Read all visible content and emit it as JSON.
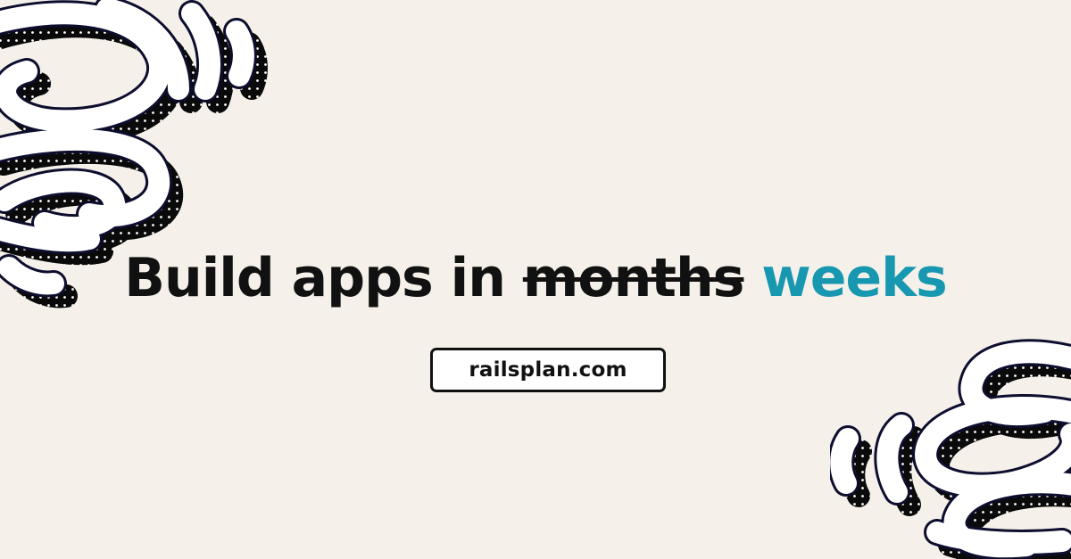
{
  "headline": {
    "prefix": "Build apps in",
    "struck_word": "months",
    "accent_word": "weeks"
  },
  "link": {
    "label": "railsplan.com"
  },
  "colors": {
    "background": "#f5f1ea",
    "text": "#111111",
    "accent": "#1797b0",
    "ribbon_fill": "#ffffff",
    "ribbon_outline": "#0d0d2e",
    "ribbon_shadow": "#0a0a0a"
  },
  "decorations": {
    "top_left": "spiral-ribbon-graphic",
    "bottom_right": "spiral-ribbon-graphic"
  }
}
